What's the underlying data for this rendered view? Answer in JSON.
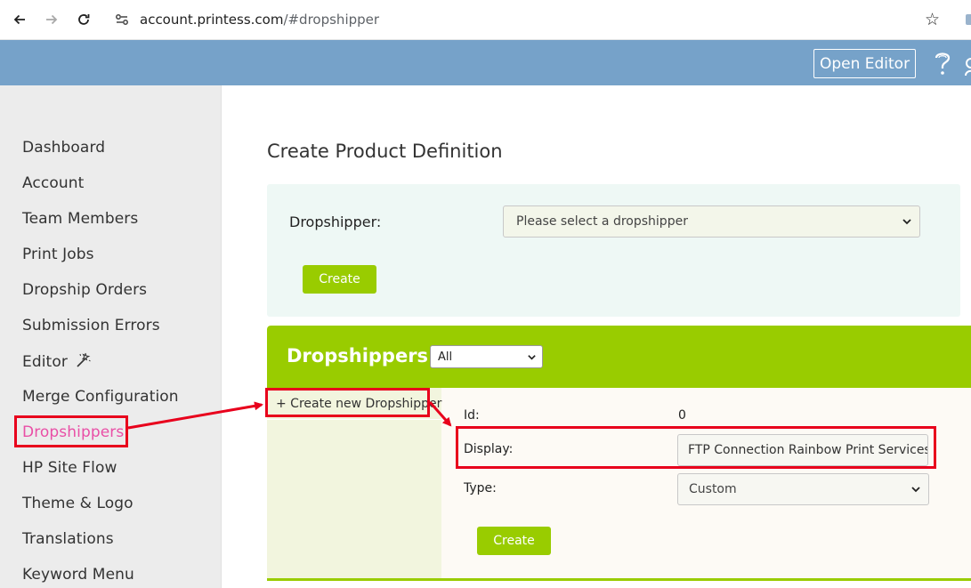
{
  "browser": {
    "url_host": "account.printess.com",
    "url_path": "/#dropshipper"
  },
  "header": {
    "open_editor_label": "Open Editor"
  },
  "sidebar": {
    "items": [
      {
        "label": "Dashboard"
      },
      {
        "label": "Account"
      },
      {
        "label": "Team Members"
      },
      {
        "label": "Print Jobs"
      },
      {
        "label": "Dropship Orders"
      },
      {
        "label": "Submission Errors"
      },
      {
        "label": "Editor",
        "icon": "magic-wand-icon"
      },
      {
        "label": "Merge Configuration"
      },
      {
        "label": "Dropshippers",
        "active": true
      },
      {
        "label": "HP Site Flow"
      },
      {
        "label": "Theme & Logo"
      },
      {
        "label": "Translations"
      },
      {
        "label": "Keyword Menu"
      }
    ]
  },
  "main": {
    "title": "Create Product Definition",
    "dropshipper_label": "Dropshipper:",
    "dropshipper_select": "Please select a dropshipper",
    "create_label": "Create"
  },
  "dropshippers": {
    "title": "Dropshippers",
    "filter_value": "All",
    "create_new_label": "+ Create new Dropshipper",
    "form": {
      "id_label": "Id:",
      "id_value": "0",
      "display_label": "Display:",
      "display_value": "FTP Connection Rainbow Print Services",
      "type_label": "Type:",
      "type_value": "Custom",
      "create_label": "Create"
    }
  },
  "colors": {
    "header_blue": "#76a2c9",
    "accent_green": "#99cc00",
    "active_pink": "#e94fa6",
    "annotation_red": "#e8001c"
  }
}
